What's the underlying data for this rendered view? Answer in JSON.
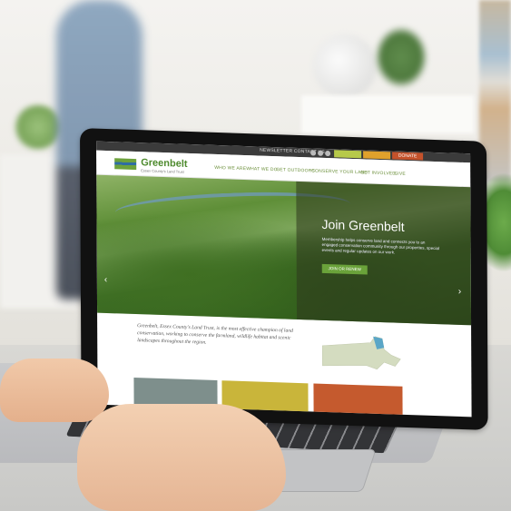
{
  "website": {
    "utility_text": "NEWSLETTER  CONTACT US",
    "top_buttons": [
      {
        "label": "",
        "color": "#b7c94a"
      },
      {
        "label": "",
        "color": "#e0a12c"
      },
      {
        "label": "DONATE",
        "color": "#c4522b"
      }
    ],
    "logo": {
      "name": "Greenbelt",
      "tagline": "Essex County's Land Trust"
    },
    "nav_items": [
      "WHO WE ARE",
      "WHAT WE DO",
      "GET OUTDOORS",
      "CONSERVE YOUR LAND",
      "GET INVOLVED",
      "GIVE"
    ],
    "hero": {
      "title": "Join Greenbelt",
      "body": "Membership helps conserve land and connects you to an engaged conservation community through our properties, special events and regular updates on our work.",
      "button": "JOIN OR RENEW"
    },
    "intro": "Greenbelt, Essex County's Land Trust, is the most effective champion of land conservation, working to conserve the farmland, wildlife habitat and scenic landscapes throughout the region.",
    "card_colors": [
      "#7e8f8c",
      "#c9b53a",
      "#c55a2e"
    ],
    "accent": "#6aa23a"
  }
}
